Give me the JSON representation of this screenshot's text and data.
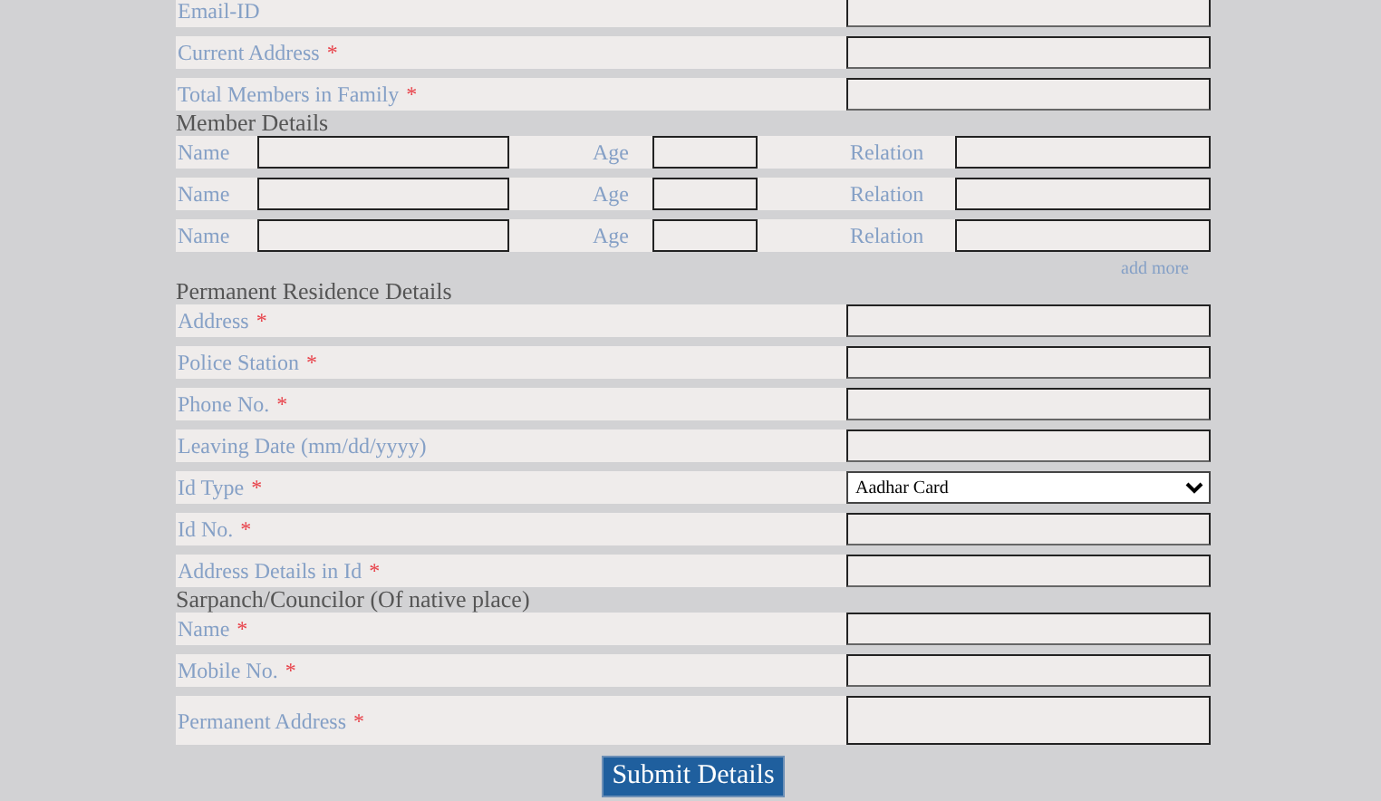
{
  "sections": [
    {
      "fields": [
        {
          "label": "Email-ID",
          "kind": "text"
        },
        {
          "label": "Current Address",
          "required_mark": "*",
          "kind": "text"
        },
        {
          "label": "Total Members in Family",
          "required_mark": "*",
          "kind": "text"
        }
      ]
    },
    {
      "heading": "Member Details",
      "members": [
        {
          "name_label": "Name",
          "age_label": "Age",
          "relation_label": "Relation"
        },
        {
          "name_label": "Name",
          "age_label": "Age",
          "relation_label": "Relation"
        },
        {
          "name_label": "Name",
          "age_label": "Age",
          "relation_label": "Relation"
        }
      ],
      "add_more": "add more"
    },
    {
      "heading": "Permanent Residence Details",
      "fields": [
        {
          "label": "Address",
          "required_mark": "*",
          "kind": "text"
        },
        {
          "label": "Police Station",
          "required_mark": "*",
          "kind": "text"
        },
        {
          "label": "Phone No.",
          "required_mark": "*",
          "kind": "text"
        },
        {
          "label": "Leaving Date (mm/dd/yyyy)",
          "kind": "text"
        },
        {
          "label": "Id Type",
          "required_mark": "*",
          "kind": "select",
          "value": "Aadhar Card"
        },
        {
          "label": "Id No.",
          "required_mark": "*",
          "kind": "text"
        },
        {
          "label": "Address Details in Id",
          "required_mark": "*",
          "kind": "text"
        }
      ]
    },
    {
      "heading": "Sarpanch/Councilor (Of native place)",
      "fields": [
        {
          "label": "Name",
          "required_mark": "*",
          "kind": "text"
        },
        {
          "label": "Mobile No.",
          "required_mark": "*",
          "kind": "text"
        },
        {
          "label": "Permanent Address",
          "required_mark": "*",
          "kind": "textarea"
        }
      ]
    }
  ],
  "submit": "Submit Details"
}
